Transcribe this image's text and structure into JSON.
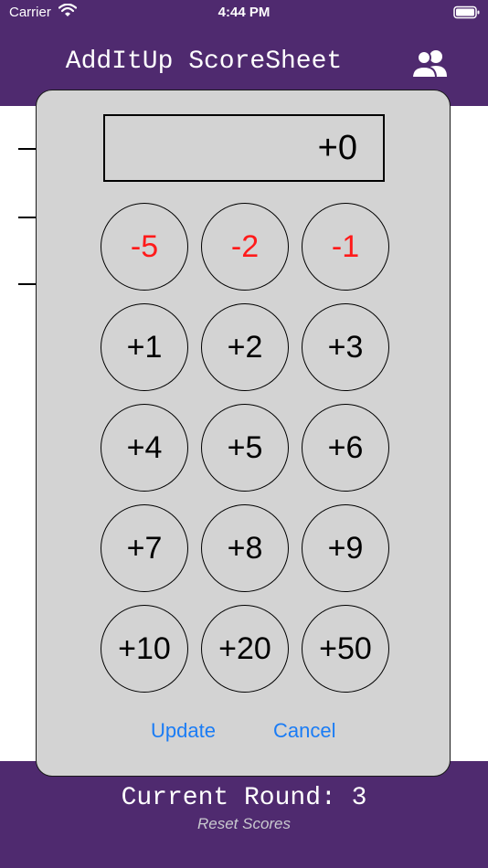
{
  "status_bar": {
    "carrier": "Carrier",
    "time": "4:44 PM"
  },
  "header": {
    "title": "AddItUp ScoreSheet",
    "players_icon": "people-icon"
  },
  "dialog": {
    "display_value": "+0",
    "keys": [
      {
        "label": "-5",
        "negative": true
      },
      {
        "label": "-2",
        "negative": true
      },
      {
        "label": "-1",
        "negative": true
      },
      {
        "label": "+1",
        "negative": false
      },
      {
        "label": "+2",
        "negative": false
      },
      {
        "label": "+3",
        "negative": false
      },
      {
        "label": "+4",
        "negative": false
      },
      {
        "label": "+5",
        "negative": false
      },
      {
        "label": "+6",
        "negative": false
      },
      {
        "label": "+7",
        "negative": false
      },
      {
        "label": "+8",
        "negative": false
      },
      {
        "label": "+9",
        "negative": false
      },
      {
        "label": "+10",
        "negative": false
      },
      {
        "label": "+20",
        "negative": false
      },
      {
        "label": "+50",
        "negative": false
      }
    ],
    "update_label": "Update",
    "cancel_label": "Cancel"
  },
  "footer": {
    "round_text": "Current Round: 3",
    "reset_label": "Reset Scores"
  },
  "colors": {
    "header_bg": "#4f2a6f",
    "dialog_bg": "#d3d3d3",
    "negative_key": "#ff1a1a",
    "action_link": "#1a7cf5"
  }
}
